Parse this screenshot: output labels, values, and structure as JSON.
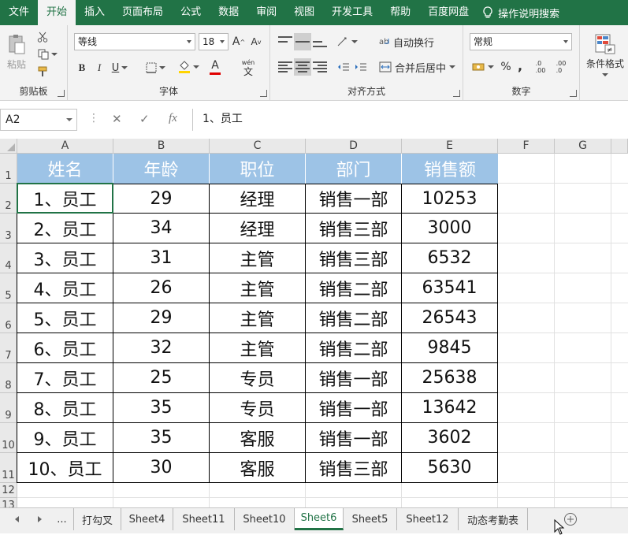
{
  "ribbon": {
    "tabs": [
      "文件",
      "开始",
      "插入",
      "页面布局",
      "公式",
      "数据",
      "审阅",
      "视图",
      "开发工具",
      "帮助",
      "百度网盘"
    ],
    "active_tab": "开始",
    "tell_me": "操作说明搜索",
    "clipboard": {
      "paste_label": "粘贴",
      "group_label": "剪贴板"
    },
    "font": {
      "name": "等线",
      "size": "18",
      "bold": "B",
      "italic": "I",
      "underline": "U",
      "grow": "A",
      "shrink": "A",
      "font_color_letter": "A",
      "wen": "wén",
      "wen_char": "文",
      "group_label": "字体"
    },
    "alignment": {
      "wrap_text": "自动换行",
      "merge_center": "合并后居中",
      "group_label": "对齐方式"
    },
    "number": {
      "format": "常规",
      "percent": "%",
      "comma": ",",
      "inc_decimal": ".0\n.00",
      "dec_decimal": ".00\n.0",
      "group_label": "数字"
    },
    "styles": {
      "conditional_format": "条件格式"
    }
  },
  "formula_bar": {
    "name_box": "A2",
    "fx": "fx",
    "content": "1、员工"
  },
  "columns": [
    "A",
    "B",
    "C",
    "D",
    "E",
    "F",
    "G"
  ],
  "rows": [
    "1",
    "2",
    "3",
    "4",
    "5",
    "6",
    "7",
    "8",
    "9",
    "10",
    "11",
    "12",
    "13"
  ],
  "table": {
    "headers": [
      "姓名",
      "年龄",
      "职位",
      "部门",
      "销售额"
    ],
    "rows": [
      [
        "1、员工",
        "29",
        "经理",
        "销售一部",
        "10253"
      ],
      [
        "2、员工",
        "34",
        "经理",
        "销售三部",
        "3000"
      ],
      [
        "3、员工",
        "31",
        "主管",
        "销售三部",
        "6532"
      ],
      [
        "4、员工",
        "26",
        "主管",
        "销售二部",
        "63541"
      ],
      [
        "5、员工",
        "29",
        "主管",
        "销售二部",
        "26543"
      ],
      [
        "6、员工",
        "32",
        "主管",
        "销售二部",
        "9845"
      ],
      [
        "7、员工",
        "25",
        "专员",
        "销售一部",
        "25638"
      ],
      [
        "8、员工",
        "35",
        "专员",
        "销售一部",
        "13642"
      ],
      [
        "9、员工",
        "35",
        "客服",
        "销售一部",
        "3602"
      ],
      [
        "10、员工",
        "30",
        "客服",
        "销售三部",
        "5630"
      ]
    ]
  },
  "sheet_tabs": [
    "...",
    "打勾叉",
    "Sheet4",
    "Sheet11",
    "Sheet10",
    "Sheet6",
    "Sheet5",
    "Sheet12",
    "动态考勤表"
  ],
  "active_sheet": "Sheet6",
  "colors": {
    "ribbon_green": "#217346",
    "header_fill": "#9dc3e6"
  }
}
